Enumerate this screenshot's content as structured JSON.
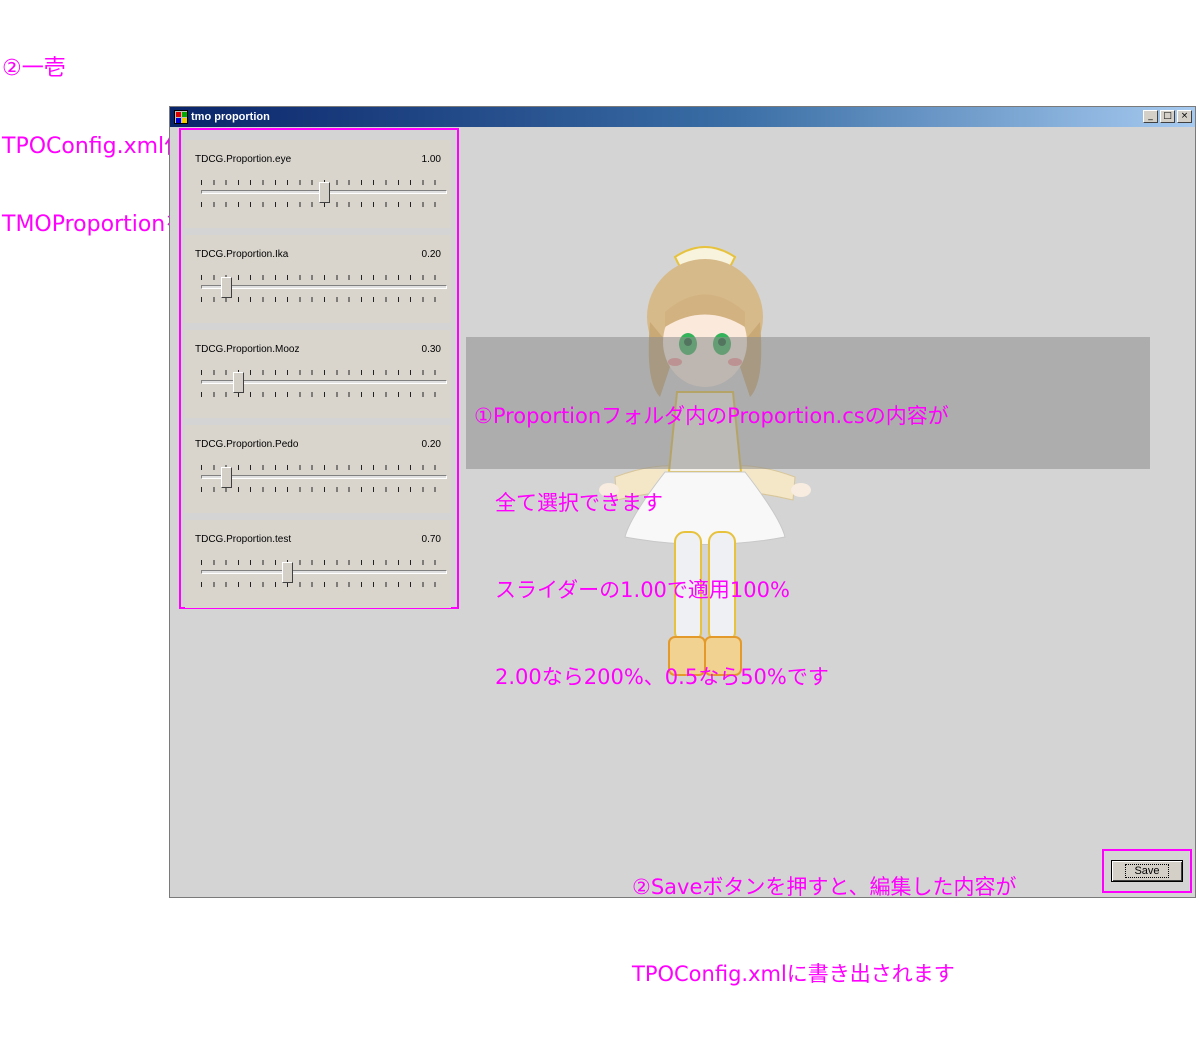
{
  "annotations": {
    "top_lines": [
      "②一壱",
      "TPOConfig.xml作り",
      "TMOProportionを開きます"
    ],
    "info_lines": [
      "①Proportionフォルダ内のProportion.csの内容が",
      "　全て選択できます",
      "　スライダーの1.00で適用100%",
      "　2.00なら200%、0.5なら50%です"
    ],
    "bottom_lines": [
      "②Saveボタンを押すと、編集した内容が",
      "TPOConfig.xmlに書き出されます"
    ]
  },
  "window": {
    "title": "tmo proportion",
    "controls": {
      "minimize": "_",
      "maximize": "□",
      "close": "×"
    }
  },
  "sliders": [
    {
      "label": "TDCG.Proportion.eye",
      "value": "1.00",
      "position": 0.5
    },
    {
      "label": "TDCG.Proportion.Ika",
      "value": "0.20",
      "position": 0.1
    },
    {
      "label": "TDCG.Proportion.Mooz",
      "value": "0.30",
      "position": 0.15
    },
    {
      "label": "TDCG.Proportion.Pedo",
      "value": "0.20",
      "position": 0.1
    },
    {
      "label": "TDCG.Proportion.test",
      "value": "0.70",
      "position": 0.35
    }
  ],
  "save_button": {
    "label": "Save"
  },
  "colors": {
    "annotation": "#ff00ff",
    "titlebar": "#0a246a",
    "window_bg": "#d4d4d4"
  }
}
